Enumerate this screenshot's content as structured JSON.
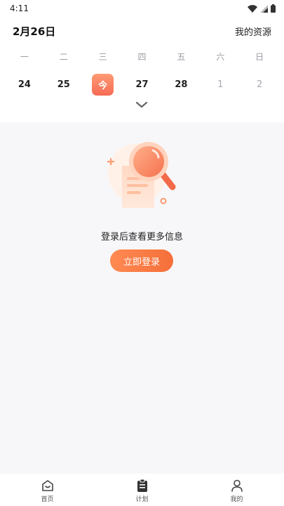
{
  "status_bar": {
    "time": "4:11"
  },
  "header": {
    "date_title": "2月26日",
    "resources_link": "我的资源"
  },
  "calendar": {
    "weekdays": [
      "一",
      "二",
      "三",
      "四",
      "五",
      "六",
      "日"
    ],
    "dates": [
      {
        "label": "24",
        "state": "normal"
      },
      {
        "label": "25",
        "state": "normal"
      },
      {
        "label": "今",
        "state": "today"
      },
      {
        "label": "27",
        "state": "normal"
      },
      {
        "label": "28",
        "state": "normal"
      },
      {
        "label": "1",
        "state": "next-month"
      },
      {
        "label": "2",
        "state": "next-month"
      }
    ]
  },
  "empty_state": {
    "message": "登录后查看更多信息",
    "button_label": "立即登录"
  },
  "tab_bar": {
    "items": [
      {
        "label": "首页",
        "icon": "home-icon"
      },
      {
        "label": "计划",
        "icon": "clipboard-icon",
        "active": true
      },
      {
        "label": "我的",
        "icon": "person-icon"
      }
    ]
  },
  "colors": {
    "accent": "#f56f3a",
    "today_badge": "#f56b55",
    "background": "#f7f7f9"
  }
}
